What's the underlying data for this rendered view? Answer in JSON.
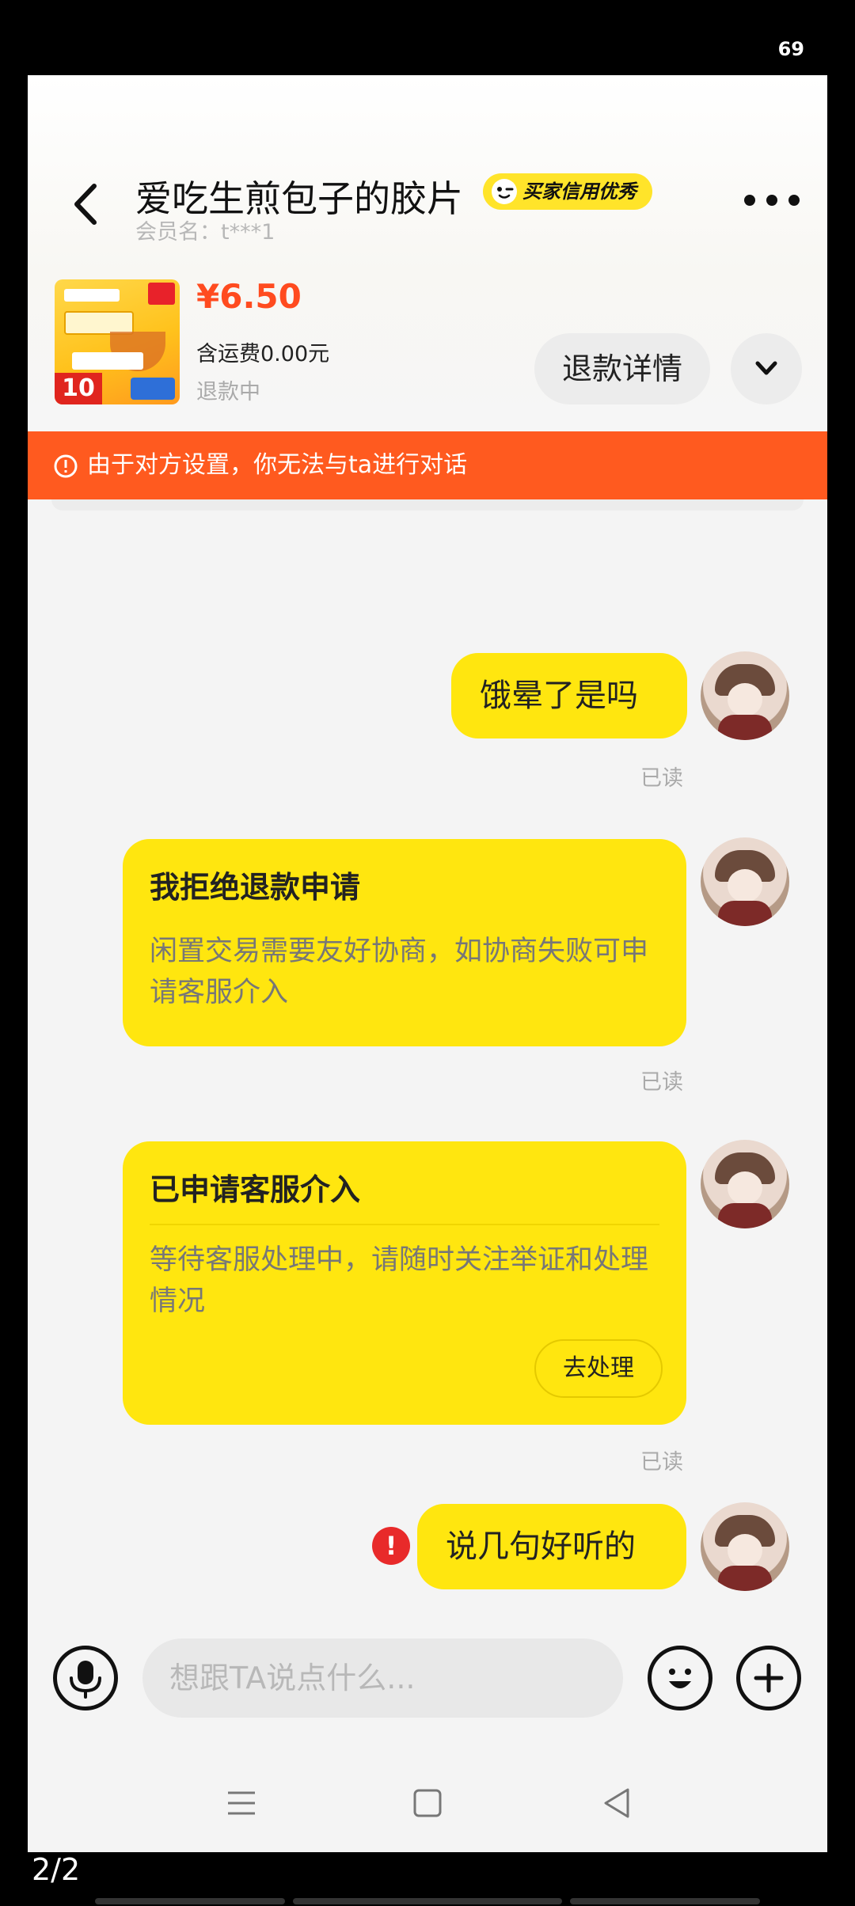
{
  "status_bar": {
    "battery": "69"
  },
  "header": {
    "title": "爱吃生煎包子的胶片",
    "credit_badge": "买家信用优秀",
    "member_label": "会员名：t***1"
  },
  "product": {
    "price": "¥6.50",
    "shipping": "含运费0.00元",
    "status": "退款中",
    "thumb_number": "10",
    "refund_button": "退款详情"
  },
  "warning": {
    "text": "由于对方设置，你无法与ta进行对话"
  },
  "messages": {
    "m1": {
      "text": "饿晕了是吗",
      "read": "已读"
    },
    "m2": {
      "title": "我拒绝退款申请",
      "body": "闲置交易需要友好协商，如协商失败可申请客服介入",
      "read": "已读"
    },
    "m3": {
      "title": "已申请客服介入",
      "body": "等待客服处理中，请随时关注举证和处理情况",
      "button": "去处理",
      "read": "已读"
    },
    "m4": {
      "text": "说几句好听的",
      "fail_mark": "!"
    }
  },
  "input": {
    "placeholder": "想跟TA说点什么..."
  },
  "pager": {
    "text": "2/2"
  },
  "colors": {
    "accent_yellow": "#ffe60f",
    "warn_orange": "#ff5a1f",
    "price_red": "#ff4b1f"
  },
  "icons": {
    "back": "chevron-left-icon",
    "more": "more-dots-icon",
    "expand": "chevron-down-icon",
    "warning": "info-circle-icon",
    "mic": "microphone-icon",
    "emoji": "smile-icon",
    "plus": "plus-icon",
    "nav_menu": "menu-icon",
    "nav_home": "home-icon",
    "nav_back": "back-triangle-icon"
  }
}
